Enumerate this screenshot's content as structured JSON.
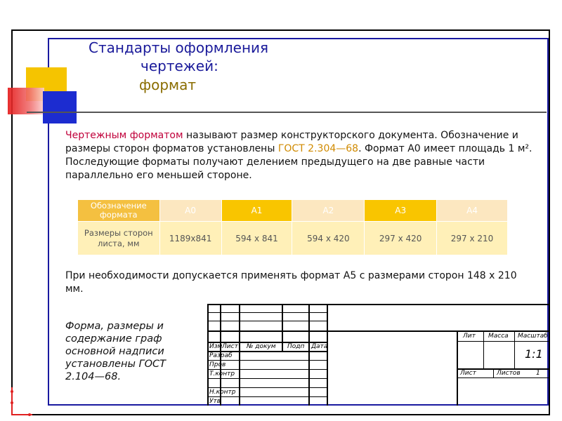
{
  "title": {
    "line1": "Стандарты оформления",
    "line2": "чертежей:",
    "line3": "формат"
  },
  "intro": {
    "term": "Чертежным форматом",
    "part1": " называют размер конструкторского документа. Обозначение и размеры сторон форматов установлены ",
    "gost": "ГОСТ 2.304—68",
    "part2": ". Формат А0 имеет площадь 1 м². Последующие форматы получают делением предыдущего на две равные части параллельно его меньшей стороне."
  },
  "table": {
    "header_label": "Обозначение формата",
    "row_label": "Размеры сторон листа, мм",
    "formats": [
      "А0",
      "А1",
      "А2",
      "А3",
      "А4"
    ],
    "sizes": [
      "1189x841",
      "594 x 841",
      "594 x 420",
      "297 x 420",
      "297 x 210"
    ]
  },
  "a5_text": "При необходимости допускается применять формат А5 с размерами сторон 148 x 210 мм.",
  "note": "Форма, размеры и содержание граф основной надписи установлены ГОСТ 2.104—68.",
  "stamp": {
    "izm": "Изм",
    "list": "Лист",
    "doc": "№ докум",
    "podp": "Подп",
    "data": "Дата",
    "razrab": "Разраб",
    "prov": "Пров",
    "tkontr": "Т.контр",
    "nkontr": "Н.контр",
    "utv": "Утв",
    "lit": "Лит",
    "massa": "Масса",
    "masshtab": "Масштаб",
    "scale_value": "1:1",
    "list2": "Лист",
    "listov": "Листов",
    "listov_value": "1"
  },
  "colors": {
    "title": "#1a1a9a",
    "accent_yellow": "#f5c400",
    "accent_red": "#e41616",
    "accent_blue": "#1c2cd0",
    "term_red": "#c0003a",
    "gost_orange": "#d08a00"
  }
}
